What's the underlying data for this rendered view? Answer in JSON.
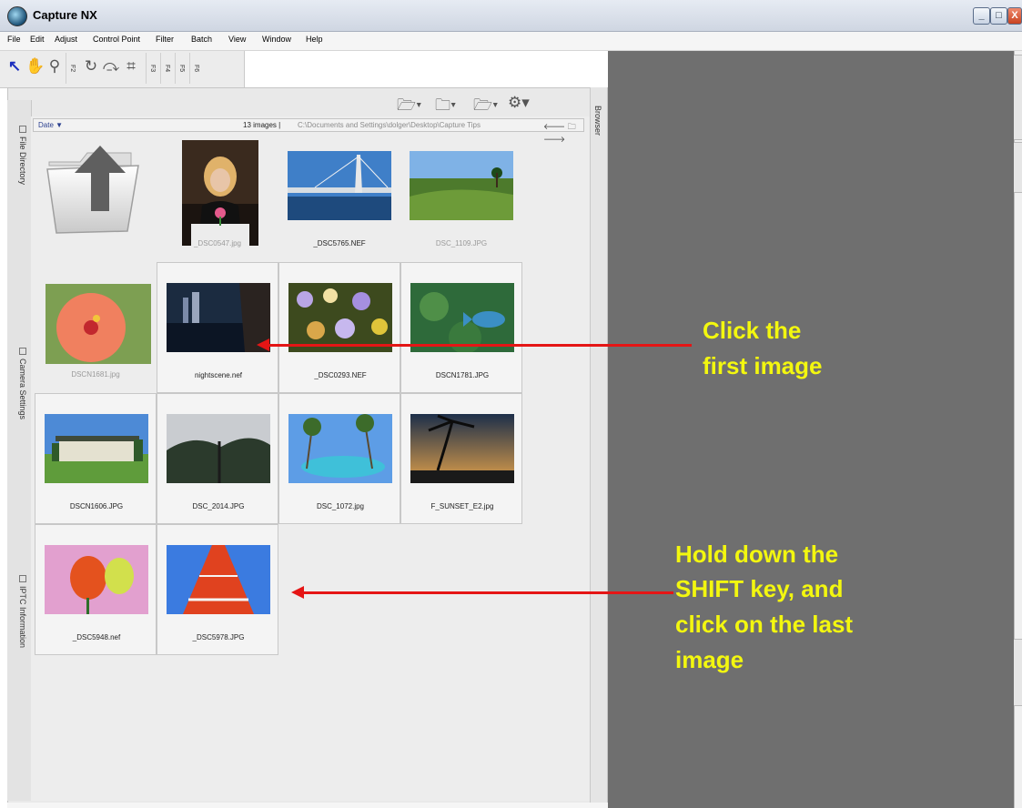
{
  "window": {
    "title": "Capture NX",
    "min_glyph": "_",
    "max_glyph": "□",
    "close_glyph": "X"
  },
  "menu": [
    "File",
    "Edit",
    "Adjust",
    "Control Point",
    "Filter",
    "Batch",
    "View",
    "Window",
    "Help"
  ],
  "toolbar": {
    "fkeys": [
      "F2",
      "F3",
      "F4",
      "F5",
      "F6"
    ]
  },
  "side_tabs": [
    "File Directory",
    "Camera Settings",
    "IPTC Information"
  ],
  "browser": {
    "label": "Browser",
    "sort_label": "Date",
    "image_count": "13 images |",
    "path": "C:\\Documents and Settings\\dolger\\Desktop\\Capture Tips"
  },
  "thumbnails": [
    {
      "caption": "_DSC0547.jpg",
      "dim": true
    },
    {
      "caption": "_DSC5765.NEF",
      "dim": false
    },
    {
      "caption": "DSC_1109.JPG",
      "dim": true
    },
    {
      "caption": "DSCN1681.jpg",
      "dim": true
    },
    {
      "caption": "nightscene.nef",
      "dim": false
    },
    {
      "caption": "_DSC0293.NEF",
      "dim": false
    },
    {
      "caption": "DSCN1781.JPG",
      "dim": false
    },
    {
      "caption": "DSCN1606.JPG",
      "dim": false
    },
    {
      "caption": "DSC_2014.JPG",
      "dim": false
    },
    {
      "caption": "DSC_1072.jpg",
      "dim": false
    },
    {
      "caption": "F_SUNSET_E2.jpg",
      "dim": false
    },
    {
      "caption": "_DSC5948.nef",
      "dim": false
    },
    {
      "caption": "_DSC5978.JPG",
      "dim": false
    }
  ],
  "annotations": {
    "first": [
      "Click the",
      "first image"
    ],
    "last": [
      " Hold down the",
      "SHIFT key, and",
      "click on the last",
      "image"
    ],
    "text_color": "#f3f70f",
    "arrow_color": "#e51515"
  }
}
